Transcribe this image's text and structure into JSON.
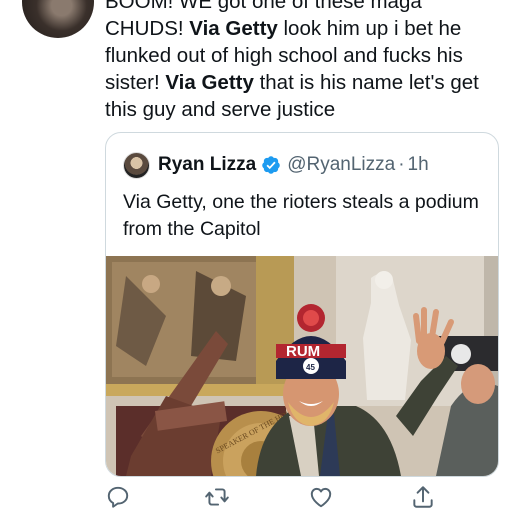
{
  "tweet": {
    "text_line1": "BOOM! WE got one of these maga",
    "text_line2": "CHUDS! ",
    "bold_1": "Via Getty",
    "text_line2_rest": " look him up i bet he",
    "text_line3": "flunked out of high school and fucks his",
    "text_line4_start": "sister! ",
    "bold_2": "Via Getty",
    "text_line4_rest": " that is his name let's get",
    "text_line5": "this guy and serve justice"
  },
  "quote": {
    "author_name": "Ryan Lizza",
    "handle": "@RyanLizza",
    "separator": "·",
    "time": "1h",
    "text": "Via Getty, one the rioters steals a podium from the Capitol",
    "media": {
      "hat_text": "RUM",
      "badge_number": "45",
      "seal_text": "SPEAKER OF THE HOUSE"
    }
  },
  "icons": {
    "reply": "reply-icon",
    "retweet": "retweet-icon",
    "like": "like-icon",
    "share": "share-icon",
    "verified": "verified-badge-icon"
  },
  "colors": {
    "text": "#0f1419",
    "secondary": "#536471",
    "verified_blue": "#1d9bf0",
    "border": "#cfd9de"
  }
}
